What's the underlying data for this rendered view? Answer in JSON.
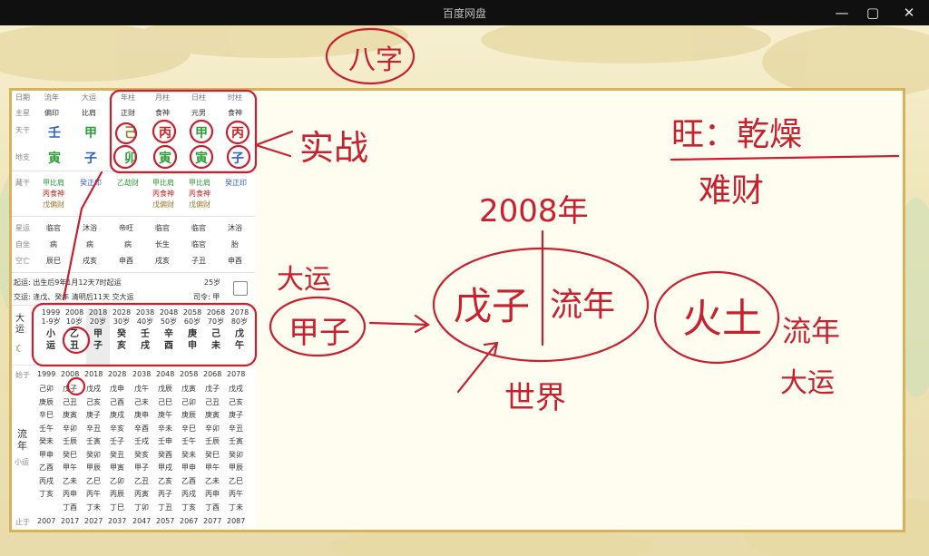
{
  "window": {
    "title": "百度网盘"
  },
  "chart": {
    "headers": [
      "日期",
      "流年",
      "大运",
      "年柱",
      "月柱",
      "日柱",
      "时柱"
    ],
    "zhuxing": [
      "主星",
      "偏印",
      "比肩",
      "正财",
      "食神",
      "元男",
      "食神"
    ],
    "tiangan": [
      "天干",
      "壬",
      "甲",
      "己",
      "丙",
      "甲",
      "丙"
    ],
    "dizhi": [
      "地支",
      "寅",
      "子",
      "卯",
      "寅",
      "寅",
      "子"
    ],
    "canggan_label": "藏干",
    "canggan": [
      [
        "甲比肩",
        "丙食神",
        "戊偏财"
      ],
      [
        "癸正印"
      ],
      [
        "乙劫财"
      ],
      [
        "甲比肩",
        "丙食神",
        "戊偏财"
      ],
      [
        "甲比肩",
        "丙食神",
        "戊偏财"
      ],
      [
        "癸正印"
      ]
    ],
    "xingyun": [
      "星运",
      "临官",
      "沐浴",
      "帝旺",
      "临官",
      "临官",
      "沐浴"
    ],
    "zizuo": [
      "自坐",
      "病",
      "病",
      "病",
      "长生",
      "临官",
      "胎"
    ],
    "kongwang": [
      "空亡",
      "辰巳",
      "戌亥",
      "申酉",
      "戌亥",
      "子丑",
      "申酉"
    ],
    "qiyun": "起运: 出生后9年1月12天7时起运",
    "qiyun_age": "25岁",
    "jiaoyun": "交运: 逢戊、癸年 清明后11天 交大运",
    "siling": "司令: 甲",
    "dayun_label": "大运",
    "dayun": [
      {
        "year": "1999",
        "age": "1-9岁",
        "gz": "小运"
      },
      {
        "year": "2008",
        "age": "10岁",
        "gz": "乙丑"
      },
      {
        "year": "2018",
        "age": "20岁",
        "gz": "甲子"
      },
      {
        "year": "2028",
        "age": "30岁",
        "gz": "癸亥"
      },
      {
        "year": "2038",
        "age": "40岁",
        "gz": "壬戌"
      },
      {
        "year": "2048",
        "age": "50岁",
        "gz": "辛酉"
      },
      {
        "year": "2058",
        "age": "60岁",
        "gz": "庚申"
      },
      {
        "year": "2068",
        "age": "70岁",
        "gz": "己未"
      },
      {
        "year": "2078",
        "age": "80岁",
        "gz": "戊午"
      }
    ],
    "liunian_start_label": "始于",
    "liunian_end_label": "止于",
    "liunian_label": "流年",
    "xiaoyun_label": "小运",
    "liunian_start": [
      "1999",
      "2008",
      "2018",
      "2028",
      "2038",
      "2048",
      "2058",
      "2068",
      "2078"
    ],
    "liunian_end": [
      "2007",
      "2017",
      "2027",
      "2037",
      "2047",
      "2057",
      "2067",
      "2077",
      "2087"
    ],
    "liunian_cols": [
      [
        "己卯",
        "庚辰",
        "辛巳",
        "壬午",
        "癸未",
        "甲申",
        "乙酉",
        "丙戌",
        "丁亥"
      ],
      [
        "戊子",
        "己丑",
        "庚寅",
        "辛卯",
        "壬辰",
        "癸巳",
        "甲午",
        "乙未",
        "丙申",
        "丁酉"
      ],
      [
        "戊戌",
        "己亥",
        "庚子",
        "辛丑",
        "壬寅",
        "癸卯",
        "甲辰",
        "乙巳",
        "丙午",
        "丁未"
      ],
      [
        "戊申",
        "己酉",
        "庚戌",
        "辛亥",
        "壬子",
        "癸丑",
        "甲寅",
        "乙卯",
        "丙辰",
        "丁巳"
      ],
      [
        "戊午",
        "己未",
        "庚申",
        "辛酉",
        "壬戌",
        "癸亥",
        "甲子",
        "乙丑",
        "丙寅",
        "丁卯"
      ],
      [
        "戊辰",
        "己巳",
        "庚午",
        "辛未",
        "壬申",
        "癸酉",
        "甲戌",
        "乙亥",
        "丙子",
        "丁丑"
      ],
      [
        "戊寅",
        "己卯",
        "庚辰",
        "辛巳",
        "壬午",
        "癸未",
        "甲申",
        "乙酉",
        "丙戌",
        "丁亥"
      ],
      [
        "戊子",
        "己丑",
        "庚寅",
        "辛卯",
        "壬辰",
        "癸巳",
        "甲午",
        "乙未",
        "丙申",
        "丁酉"
      ],
      [
        "戊戌",
        "己亥",
        "庚子",
        "辛丑",
        "壬寅",
        "癸卯",
        "甲辰",
        "乙巳",
        "丙午",
        "丁未"
      ]
    ]
  },
  "notes": {
    "title": "八字",
    "shizhan": "实战",
    "dayun": "大运",
    "dayun_gz": "甲子",
    "year": "2008年",
    "wuzi": "戊子",
    "liunian": "流年",
    "shijie": "世界",
    "huotu": "火土",
    "liunian2": "流年",
    "dayun2": "大运",
    "right1": "旺：乾燥",
    "right2": "难财"
  },
  "colors": {
    "ink": "#c8202e",
    "gold": "#d8b25a",
    "green": "#2e9e3a",
    "blue": "#2f62c8",
    "red": "#c22"
  }
}
